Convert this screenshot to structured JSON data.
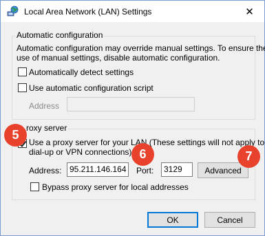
{
  "window": {
    "title": "Local Area Network (LAN) Settings",
    "close_glyph": "✕",
    "icon": "network-globe-icon"
  },
  "automatic": {
    "legend": "Automatic configuration",
    "description_line1": "Automatic configuration may override manual settings.  To ensure the",
    "description_line2": "use of manual settings, disable automatic configuration.",
    "auto_detect_label": "Automatically detect settings",
    "auto_detect_checked": false,
    "use_script_label": "Use automatic configuration script",
    "use_script_checked": false,
    "address_label": "Address",
    "address_value": ""
  },
  "proxy": {
    "legend": "roxy server",
    "use_proxy_label_line1": "Use a proxy server for your LAN (These settings will not apply to",
    "use_proxy_label_line2": "dial-up or VPN connections).",
    "use_proxy_checked": true,
    "address_label": "Address:",
    "address_value": "95.211.146.164",
    "port_label": "Port:",
    "port_value": "3129",
    "advanced_label": "Advanced",
    "bypass_label": "Bypass proxy server for local addresses",
    "bypass_checked": false
  },
  "buttons": {
    "ok": "OK",
    "cancel": "Cancel"
  },
  "badges": {
    "b5": "5",
    "b6": "6",
    "b7": "7",
    "color": "#e8412c"
  }
}
